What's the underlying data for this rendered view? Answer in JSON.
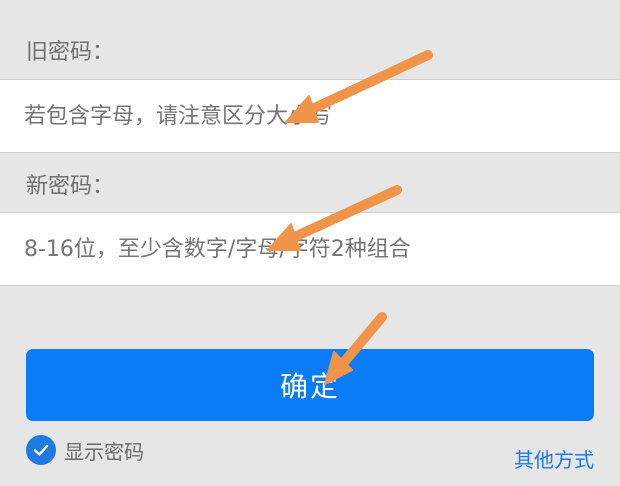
{
  "old_password": {
    "label": "旧密码：",
    "placeholder": "若包含字母，请注意区分大小写"
  },
  "new_password": {
    "label": "新密码：",
    "placeholder": "8-16位，至少含数字/字母/字符2种组合"
  },
  "confirm_button": "确定",
  "show_password_label": "显示密码",
  "other_methods_link": "其他方式",
  "colors": {
    "accent": "#0a7cf7",
    "arrow": "#f0944a"
  }
}
